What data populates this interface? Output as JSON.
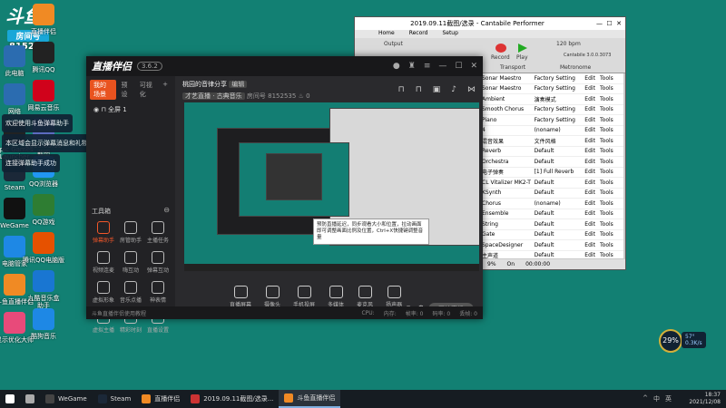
{
  "desktop": {
    "douyu_logo": "斗鱼",
    "room_label": "房间号",
    "room_number": "8152535",
    "icons_left": [
      {
        "label": "Admin",
        "color": "#e33"
      },
      {
        "label": "此电脑",
        "color": "#2b6cb0"
      },
      {
        "label": "网络",
        "color": "#2b6cb0"
      },
      {
        "label": "Epic Games\nLauncher",
        "color": "#222"
      },
      {
        "label": "Steam",
        "color": "#1b2838"
      },
      {
        "label": "WeGame",
        "color": "#111"
      },
      {
        "label": "电脑管家",
        "color": "#1e88e5"
      },
      {
        "label": "斗鱼直播伴侣",
        "color": "#f08a24"
      },
      {
        "label": "显示优化大师",
        "color": "#e84a7a"
      }
    ],
    "icons_right": [
      {
        "label": "直播伴侣",
        "color": "#f08a24"
      },
      {
        "label": "腾讯QQ",
        "color": "#222"
      },
      {
        "label": "网易云音乐",
        "color": "#d0021b"
      },
      {
        "label": "2019.09.11\n截图",
        "color": "#5c6bc0"
      },
      {
        "label": "QQ浏览器",
        "color": "#2196f3"
      },
      {
        "label": "QQ游戏",
        "color": "#2e7d32"
      },
      {
        "label": "腾讯QQ电脑版",
        "color": "#e65100"
      },
      {
        "label": "九酷音乐盒\n助手",
        "color": "#1976d2"
      },
      {
        "label": "酷狗音乐",
        "color": "#1e88e5"
      }
    ],
    "notifications": [
      "欢迎使用斗鱼弹幕助手",
      "本区域会显示弹幕消息和礼物消息",
      "连接弹幕助手成功"
    ]
  },
  "live_app": {
    "brand": "直播伴侣",
    "version_badge": "3.6.2",
    "tabs": [
      "我的场景",
      "预设",
      "可视化"
    ],
    "scene_label": "全屏 1",
    "tool_section_title": "工具箱",
    "tools": [
      "弹幕助手",
      "房管助手",
      "主播任务",
      "视频连麦",
      "嗨互动",
      "弹幕互动",
      "虚拟形象",
      "音乐点播",
      "神表情",
      "虚拟主播",
      "精彩时刻",
      "直播设置"
    ],
    "room_title": "桃园的音律分享",
    "room_title_tag": "编辑",
    "room_category": "才艺直播 · 古典音乐",
    "room_sub": "房间号 8152535",
    "room_heat": "0",
    "bottom_tools": [
      "直播屏幕",
      "摄像头",
      "手机投屏",
      "多媒体",
      "麦克风",
      "扬声器"
    ],
    "start_button": "开始直播",
    "statusbar": [
      "斗鱼直播伴侣使用教程",
      "CPU:",
      "内存:",
      "帧率: 0",
      "码率: 0",
      "丢帧: 0"
    ],
    "preview_caption": "预防直播延迟，同步观看大小和位置，拉动画面即可调整画面比例及位置，Ctrl+X快捷键调整音量"
  },
  "cantabile": {
    "title": "2019.09.11截图/选录 - Cantabile Performer",
    "menu": [
      "Home",
      "Record",
      "Setup"
    ],
    "ribbon_labels": [
      "Output",
      "Record",
      "Play",
      "Transport",
      "Metronome",
      "120 bpm",
      "Cantabile 3.0.0.3073"
    ],
    "rows": [
      {
        "name": "Sonar Maestro",
        "preset": "Factory Setting",
        "edit": "Edit",
        "tools": "Tools"
      },
      {
        "name": "Sonar Maestro",
        "preset": "Factory Setting",
        "edit": "Edit",
        "tools": "Tools"
      },
      {
        "name": "Ambient",
        "preset": "演奏模式",
        "edit": "Edit",
        "tools": "Tools"
      },
      {
        "name": "Smooth Chorus",
        "preset": "Factory Setting",
        "edit": "Edit",
        "tools": "Tools"
      },
      {
        "name": "Piano",
        "preset": "Factory Setting",
        "edit": "Edit",
        "tools": "Tools"
      },
      {
        "name": "4",
        "preset": "(noname)",
        "edit": "Edit",
        "tools": "Tools"
      },
      {
        "name": "混音效果",
        "preset": "文件风格",
        "edit": "Edit",
        "tools": "Tools"
      },
      {
        "name": "Reverb",
        "preset": "Default",
        "edit": "Edit",
        "tools": "Tools"
      },
      {
        "name": "Orchestra",
        "preset": "Default",
        "edit": "Edit",
        "tools": "Tools"
      },
      {
        "name": "电子弹奏",
        "preset": "[1] Full Reverb",
        "edit": "Edit",
        "tools": "Tools"
      },
      {
        "name": "CL Vitalizer MK2-T",
        "preset": "Default",
        "edit": "Edit",
        "tools": "Tools"
      },
      {
        "name": "KSynth",
        "preset": "Default",
        "edit": "Edit",
        "tools": "Tools"
      },
      {
        "name": "Chorus",
        "preset": "(noname)",
        "edit": "Edit",
        "tools": "Tools"
      },
      {
        "name": "Ensemble",
        "preset": "Default",
        "edit": "Edit",
        "tools": "Tools"
      },
      {
        "name": "String",
        "preset": "Default",
        "edit": "Edit",
        "tools": "Tools"
      },
      {
        "name": "Gate",
        "preset": "Default",
        "edit": "Edit",
        "tools": "Tools"
      },
      {
        "name": "SpaceDesigner",
        "preset": "Default",
        "edit": "Edit",
        "tools": "Tools"
      },
      {
        "name": "主声道",
        "preset": "Default",
        "edit": "Edit",
        "tools": "Tools"
      },
      {
        "name": "合声",
        "preset": "Default",
        "edit": "Edit",
        "tools": "Tools"
      },
      {
        "name": "Softlite VSC-2",
        "preset": "Default",
        "edit": "Edit",
        "tools": "Tools"
      }
    ],
    "route_header": [
      "Any",
      "Omni",
      "None",
      "Out"
    ],
    "route_rows": [
      {
        "name": "Program",
        "preset": "Settings"
      },
      {
        "name": "Upper",
        "preset": "Default",
        "edit": "Edit",
        "tools": "Tools"
      },
      {
        "name": "Lower",
        "preset": "Default",
        "edit": "Edit",
        "tools": "Tools"
      }
    ],
    "status": [
      "9%",
      "On",
      "00:00:00"
    ]
  },
  "taskbar": {
    "items": [
      {
        "label": "",
        "color": "#fff"
      },
      {
        "label": "",
        "color": "#aaa"
      },
      {
        "label": "WeGame",
        "color": "#444"
      },
      {
        "label": "Steam",
        "color": "#1b2838"
      },
      {
        "label": "直播伴侣",
        "color": "#f08a24"
      },
      {
        "label": "2019.09.11截图/选录...",
        "color": "#c33"
      },
      {
        "label": "斗鱼直播伴侣",
        "color": "#f08a24"
      }
    ],
    "time": "18:37",
    "date": "2021/12/08",
    "tray": [
      "^",
      "中",
      "英"
    ]
  },
  "perf_widget": {
    "percent": "29%",
    "line1": "57°",
    "line2": "0.3K/s"
  }
}
